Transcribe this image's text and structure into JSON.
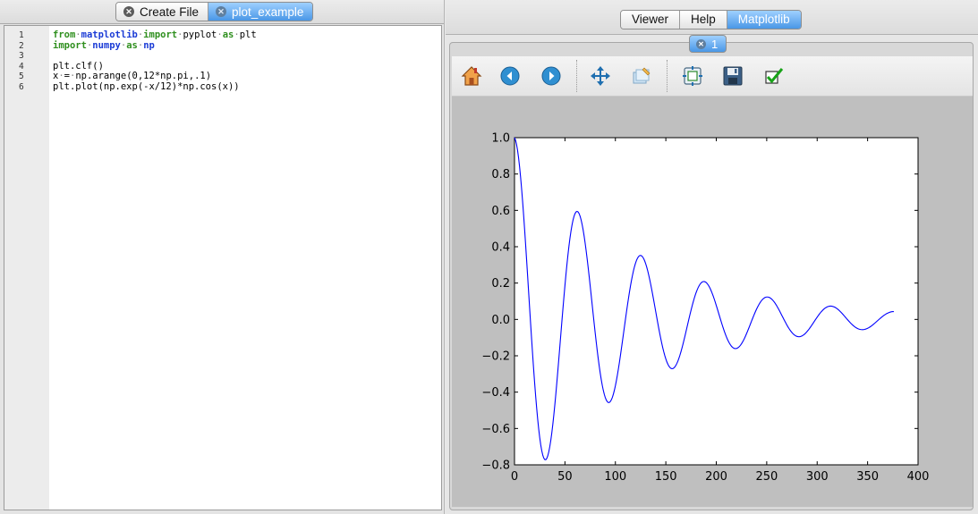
{
  "editor": {
    "tabs": [
      {
        "label": "Create File",
        "active": false
      },
      {
        "label": "plot_example",
        "active": true
      }
    ],
    "line_numbers": [
      "1",
      "2",
      "3",
      "4",
      "5",
      "6"
    ],
    "code_lines": [
      "from·matplotlib·import·pyplot·as·plt",
      "import·numpy·as·np",
      "",
      "plt.clf()",
      "x·=·np.arange(0,12*np.pi,.1)",
      "plt.plot(np.exp(-x/12)*np.cos(x))"
    ]
  },
  "right_panel": {
    "tabs": [
      {
        "label": "Viewer",
        "active": false
      },
      {
        "label": "Help",
        "active": false
      },
      {
        "label": "Matplotlib",
        "active": true
      }
    ],
    "figure_tab": "1",
    "toolbar": [
      {
        "name": "home-icon",
        "tooltip": "Home"
      },
      {
        "name": "back-icon",
        "tooltip": "Back"
      },
      {
        "name": "forward-icon",
        "tooltip": "Forward"
      },
      {
        "name": "pan-icon",
        "tooltip": "Pan"
      },
      {
        "name": "zoom-icon",
        "tooltip": "Zoom"
      },
      {
        "name": "subplots-icon",
        "tooltip": "Subplots"
      },
      {
        "name": "save-icon",
        "tooltip": "Save"
      },
      {
        "name": "apply-icon",
        "tooltip": "Apply"
      }
    ]
  },
  "chart_data": {
    "type": "line",
    "title": "",
    "xlabel": "",
    "ylabel": "",
    "xlim": [
      0,
      400
    ],
    "ylim": [
      -0.8,
      1.0
    ],
    "xticks": [
      "0",
      "50",
      "100",
      "150",
      "200",
      "250",
      "300",
      "350",
      "400"
    ],
    "yticks": [
      "1.0",
      "0.8",
      "0.6",
      "0.4",
      "0.2",
      "0.0",
      "−0.2",
      "−0.4",
      "−0.6",
      "−0.8"
    ],
    "grid": false,
    "series": [
      {
        "color": "#0000ff",
        "formula": "exp(-x/12)*cos(x), x = arange(0, 12*pi, 0.1), plotted vs index",
        "points": [
          [
            0,
            1.0
          ],
          [
            31,
            -0.77
          ],
          [
            63,
            0.59
          ],
          [
            94,
            -0.46
          ],
          [
            126,
            0.35
          ],
          [
            157,
            -0.27
          ],
          [
            188,
            0.21
          ],
          [
            220,
            -0.16
          ],
          [
            251,
            0.12
          ],
          [
            283,
            -0.096
          ],
          [
            314,
            0.073
          ],
          [
            345,
            -0.056
          ],
          [
            376,
            0.043
          ]
        ]
      }
    ]
  },
  "colors": {
    "accent": "#4a97e6",
    "line": "#0000ff",
    "keyword": "#2f8f1e",
    "module": "#1a3bd6"
  }
}
